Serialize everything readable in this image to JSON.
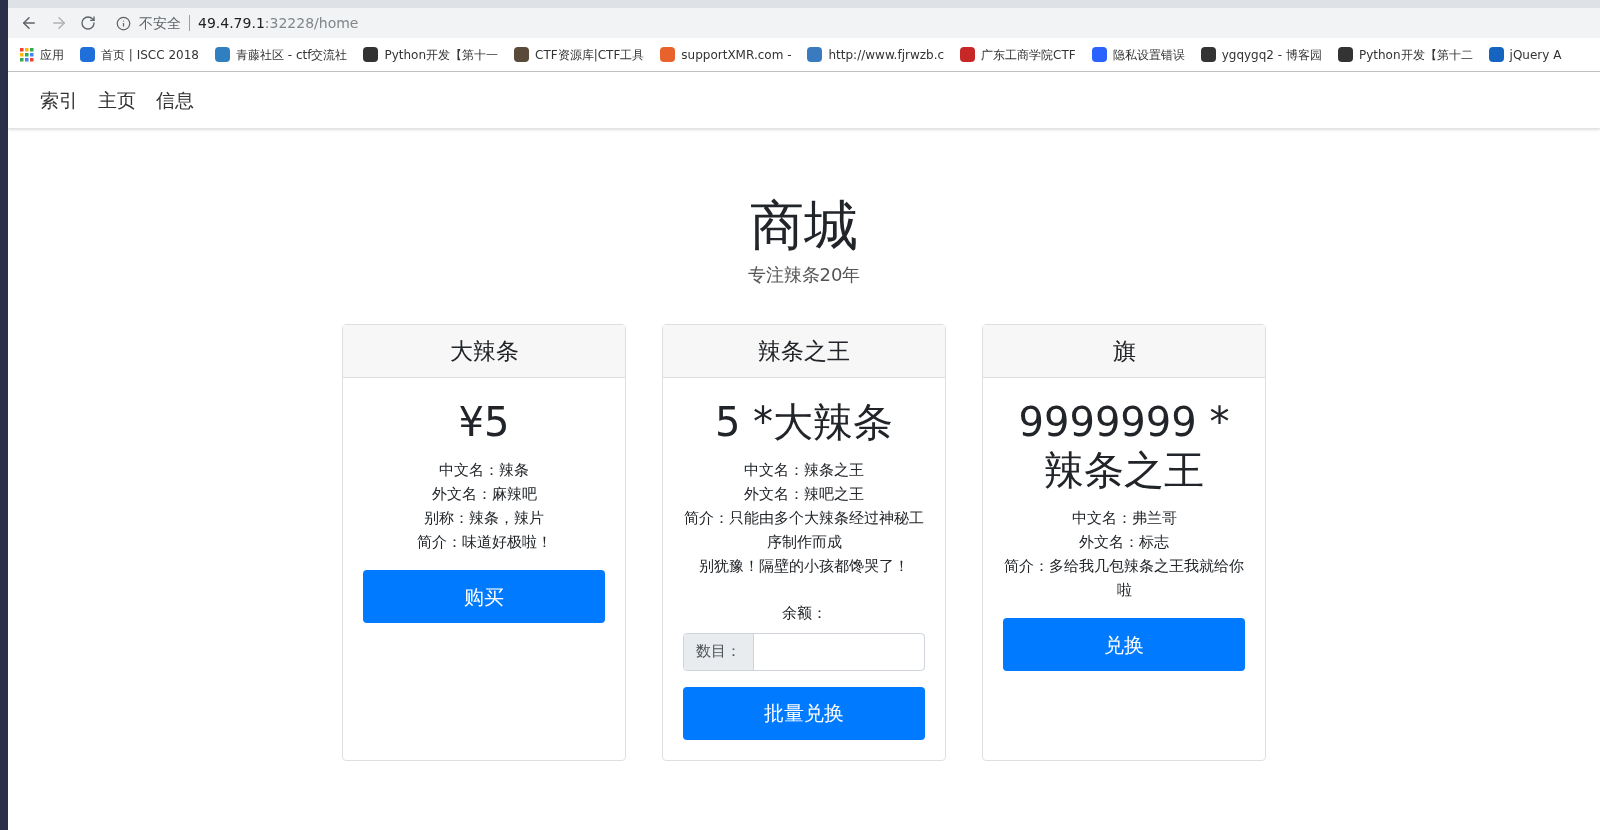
{
  "browser": {
    "security": "不安全",
    "url_host": "49.4.79.1",
    "url_path": ":32228/home"
  },
  "bookmarks": [
    "应用",
    "首页 | ISCC 2018",
    "青藤社区 - ctf交流社",
    "Python开发【第十一",
    "CTF资源库|CTF工具",
    "supportXMR.com -",
    "http://www.fjrwzb.c",
    "广东工商学院CTF",
    "隐私设置错误",
    "ygqygq2 - 博客园",
    "Python开发【第十二",
    "jQuery A"
  ],
  "navbar": [
    "索引",
    "主页",
    "信息"
  ],
  "hero": {
    "title": "商城",
    "subtitle": "专注辣条20年"
  },
  "cards": [
    {
      "kind": "buy",
      "header": "大辣条",
      "price": "¥5",
      "lines": [
        "中文名：辣条",
        "外文名：麻辣吧",
        "别称：辣条，辣片",
        "简介：味道好极啦！"
      ],
      "button": "购买"
    },
    {
      "kind": "batch",
      "header": "辣条之王",
      "price": "5 *大辣条",
      "lines": [
        "中文名：辣条之王",
        "外文名：辣吧之王",
        "简介：只能由多个大辣条经过神秘工序制作而成",
        "别犹豫！隔壁的小孩都馋哭了！"
      ],
      "balance": "余额：",
      "input_prefix": "数目：",
      "button": "批量兑换"
    },
    {
      "kind": "exchange",
      "header": "旗",
      "price": "9999999 *辣条之王",
      "lines": [
        "中文名：弗兰哥",
        "外文名：标志",
        "简介：多给我几包辣条之王我就给你啦"
      ],
      "button": "兑换"
    }
  ]
}
